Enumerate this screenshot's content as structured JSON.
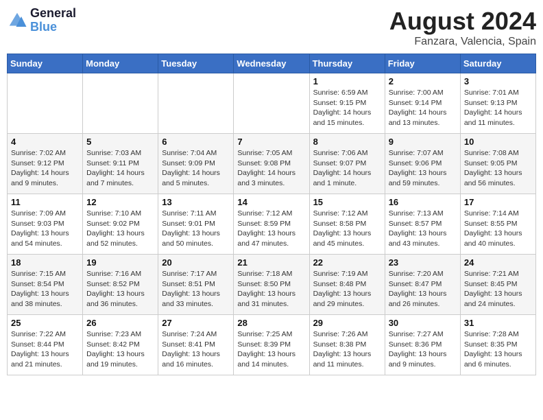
{
  "header": {
    "logo_line1": "General",
    "logo_line2": "Blue",
    "month_year": "August 2024",
    "location": "Fanzara, Valencia, Spain"
  },
  "days_of_week": [
    "Sunday",
    "Monday",
    "Tuesday",
    "Wednesday",
    "Thursday",
    "Friday",
    "Saturday"
  ],
  "weeks": [
    [
      {
        "day": "",
        "info": ""
      },
      {
        "day": "",
        "info": ""
      },
      {
        "day": "",
        "info": ""
      },
      {
        "day": "",
        "info": ""
      },
      {
        "day": "1",
        "info": "Sunrise: 6:59 AM\nSunset: 9:15 PM\nDaylight: 14 hours\nand 15 minutes."
      },
      {
        "day": "2",
        "info": "Sunrise: 7:00 AM\nSunset: 9:14 PM\nDaylight: 14 hours\nand 13 minutes."
      },
      {
        "day": "3",
        "info": "Sunrise: 7:01 AM\nSunset: 9:13 PM\nDaylight: 14 hours\nand 11 minutes."
      }
    ],
    [
      {
        "day": "4",
        "info": "Sunrise: 7:02 AM\nSunset: 9:12 PM\nDaylight: 14 hours\nand 9 minutes."
      },
      {
        "day": "5",
        "info": "Sunrise: 7:03 AM\nSunset: 9:11 PM\nDaylight: 14 hours\nand 7 minutes."
      },
      {
        "day": "6",
        "info": "Sunrise: 7:04 AM\nSunset: 9:09 PM\nDaylight: 14 hours\nand 5 minutes."
      },
      {
        "day": "7",
        "info": "Sunrise: 7:05 AM\nSunset: 9:08 PM\nDaylight: 14 hours\nand 3 minutes."
      },
      {
        "day": "8",
        "info": "Sunrise: 7:06 AM\nSunset: 9:07 PM\nDaylight: 14 hours\nand 1 minute."
      },
      {
        "day": "9",
        "info": "Sunrise: 7:07 AM\nSunset: 9:06 PM\nDaylight: 13 hours\nand 59 minutes."
      },
      {
        "day": "10",
        "info": "Sunrise: 7:08 AM\nSunset: 9:05 PM\nDaylight: 13 hours\nand 56 minutes."
      }
    ],
    [
      {
        "day": "11",
        "info": "Sunrise: 7:09 AM\nSunset: 9:03 PM\nDaylight: 13 hours\nand 54 minutes."
      },
      {
        "day": "12",
        "info": "Sunrise: 7:10 AM\nSunset: 9:02 PM\nDaylight: 13 hours\nand 52 minutes."
      },
      {
        "day": "13",
        "info": "Sunrise: 7:11 AM\nSunset: 9:01 PM\nDaylight: 13 hours\nand 50 minutes."
      },
      {
        "day": "14",
        "info": "Sunrise: 7:12 AM\nSunset: 8:59 PM\nDaylight: 13 hours\nand 47 minutes."
      },
      {
        "day": "15",
        "info": "Sunrise: 7:12 AM\nSunset: 8:58 PM\nDaylight: 13 hours\nand 45 minutes."
      },
      {
        "day": "16",
        "info": "Sunrise: 7:13 AM\nSunset: 8:57 PM\nDaylight: 13 hours\nand 43 minutes."
      },
      {
        "day": "17",
        "info": "Sunrise: 7:14 AM\nSunset: 8:55 PM\nDaylight: 13 hours\nand 40 minutes."
      }
    ],
    [
      {
        "day": "18",
        "info": "Sunrise: 7:15 AM\nSunset: 8:54 PM\nDaylight: 13 hours\nand 38 minutes."
      },
      {
        "day": "19",
        "info": "Sunrise: 7:16 AM\nSunset: 8:52 PM\nDaylight: 13 hours\nand 36 minutes."
      },
      {
        "day": "20",
        "info": "Sunrise: 7:17 AM\nSunset: 8:51 PM\nDaylight: 13 hours\nand 33 minutes."
      },
      {
        "day": "21",
        "info": "Sunrise: 7:18 AM\nSunset: 8:50 PM\nDaylight: 13 hours\nand 31 minutes."
      },
      {
        "day": "22",
        "info": "Sunrise: 7:19 AM\nSunset: 8:48 PM\nDaylight: 13 hours\nand 29 minutes."
      },
      {
        "day": "23",
        "info": "Sunrise: 7:20 AM\nSunset: 8:47 PM\nDaylight: 13 hours\nand 26 minutes."
      },
      {
        "day": "24",
        "info": "Sunrise: 7:21 AM\nSunset: 8:45 PM\nDaylight: 13 hours\nand 24 minutes."
      }
    ],
    [
      {
        "day": "25",
        "info": "Sunrise: 7:22 AM\nSunset: 8:44 PM\nDaylight: 13 hours\nand 21 minutes."
      },
      {
        "day": "26",
        "info": "Sunrise: 7:23 AM\nSunset: 8:42 PM\nDaylight: 13 hours\nand 19 minutes."
      },
      {
        "day": "27",
        "info": "Sunrise: 7:24 AM\nSunset: 8:41 PM\nDaylight: 13 hours\nand 16 minutes."
      },
      {
        "day": "28",
        "info": "Sunrise: 7:25 AM\nSunset: 8:39 PM\nDaylight: 13 hours\nand 14 minutes."
      },
      {
        "day": "29",
        "info": "Sunrise: 7:26 AM\nSunset: 8:38 PM\nDaylight: 13 hours\nand 11 minutes."
      },
      {
        "day": "30",
        "info": "Sunrise: 7:27 AM\nSunset: 8:36 PM\nDaylight: 13 hours\nand 9 minutes."
      },
      {
        "day": "31",
        "info": "Sunrise: 7:28 AM\nSunset: 8:35 PM\nDaylight: 13 hours\nand 6 minutes."
      }
    ]
  ]
}
